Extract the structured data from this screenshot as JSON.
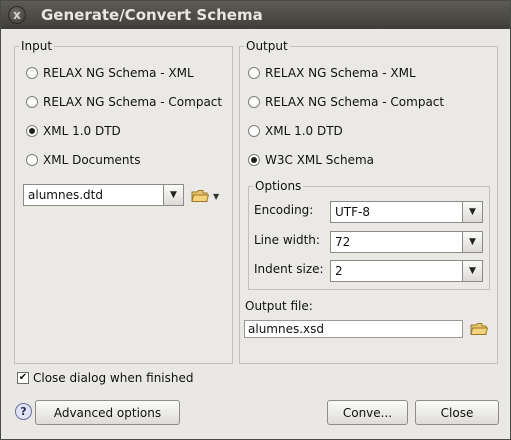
{
  "window": {
    "title": "Generate/Convert Schema",
    "close_glyph": "x"
  },
  "input": {
    "label": "Input",
    "options": [
      {
        "label": "RELAX NG Schema - XML",
        "checked": false
      },
      {
        "label": "RELAX NG Schema - Compact",
        "checked": false
      },
      {
        "label": "XML 1.0 DTD",
        "checked": true
      },
      {
        "label": "XML Documents",
        "checked": false
      }
    ],
    "file_combo_value": "alumnes.dtd",
    "browse_icon": "folder-icon",
    "dropdown_icon": "small-arrow-down-icon"
  },
  "output": {
    "label": "Output",
    "options": [
      {
        "label": "RELAX NG Schema - XML",
        "checked": false
      },
      {
        "label": "RELAX NG Schema - Compact",
        "checked": false
      },
      {
        "label": "XML 1.0 DTD",
        "checked": false
      },
      {
        "label": "W3C XML Schema",
        "checked": true
      }
    ],
    "options_group": {
      "label": "Options",
      "encoding_label": "Encoding:",
      "encoding_value": "UTF-8",
      "line_width_label": "Line width:",
      "line_width_value": "72",
      "indent_size_label": "Indent size:",
      "indent_size_value": "2"
    },
    "output_file_label": "Output file:",
    "output_file_value": "alumnes.xsd"
  },
  "footer": {
    "close_when_finished_label": "Close dialog when finished",
    "close_when_finished_checked": true,
    "help_glyph": "?",
    "advanced_button": "Advanced options",
    "convert_button": "Conve...",
    "close_button": "Close"
  },
  "colors": {
    "titlebar": "#4b4a46",
    "window_bg": "#e9e8e5"
  }
}
